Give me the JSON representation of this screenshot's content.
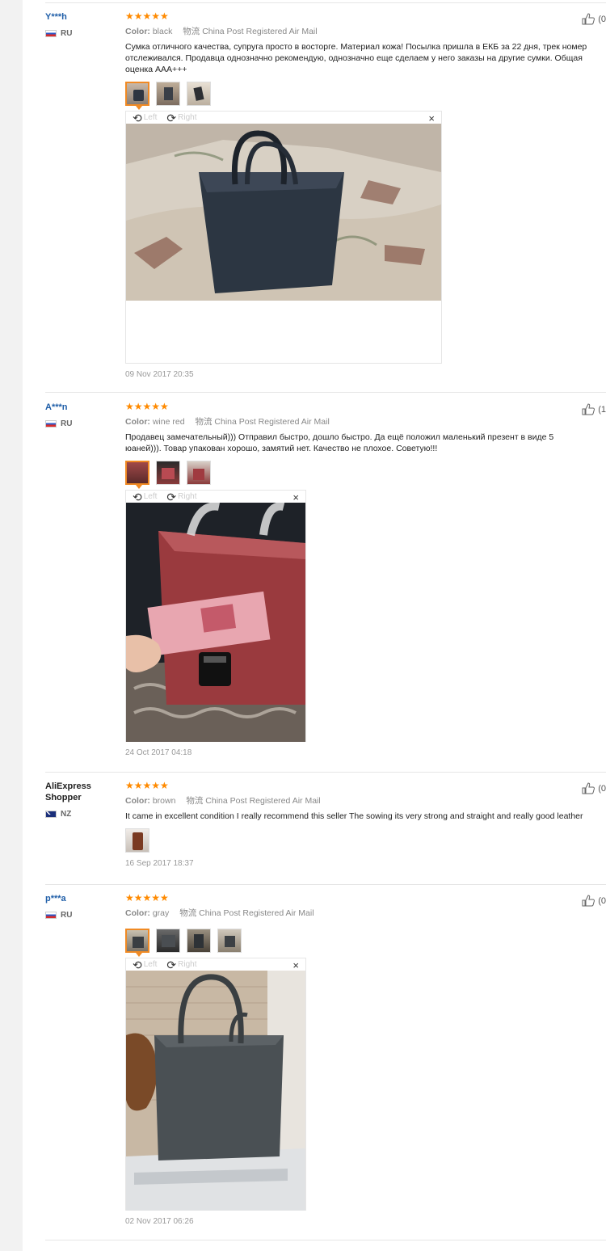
{
  "reviews": [
    {
      "user": "Y***h",
      "country": "RU",
      "stars": "★★★★★",
      "color_label": "Color:",
      "color": "black",
      "shipping_icon": "物流",
      "shipping": "China Post Registered Air Mail",
      "text": "Сумка отличного качества, супруга просто в восторге. Материал кожа! Посылка пришла в ЕКБ за 22 дня, трек номер отслеживался. Продавца однозначно рекомендую, однозначно еще сделаем у него заказы на другие сумки. Общая оценка AAA+++",
      "viewer_left": "Left",
      "viewer_right": "Right",
      "viewer_close": "×",
      "date": "09 Nov 2017 20:35",
      "likes": "(0"
    },
    {
      "user": "A***n",
      "country": "RU",
      "stars": "★★★★★",
      "color_label": "Color:",
      "color": "wine red",
      "shipping_icon": "物流",
      "shipping": "China Post Registered Air Mail",
      "text": "Продавец замечательный))) Отправил быстро, дошло быстро. Да ещё положил маленький презент в виде 5 юаней))). Товар упакован хорошо, замятий нет. Качество не плохое. Советую!!!",
      "viewer_left": "Left",
      "viewer_right": "Right",
      "viewer_close": "×",
      "date": "24 Oct 2017 04:18",
      "likes": "(1"
    },
    {
      "user": "AliExpress Shopper",
      "country": "NZ",
      "stars": "★★★★★",
      "color_label": "Color:",
      "color": "brown",
      "shipping_icon": "物流",
      "shipping": "China Post Registered Air Mail",
      "text": "It came in excellent condition I really recommend this seller The sowing its very strong and straight and really good leather",
      "date": "16 Sep 2017 18:37",
      "likes": "(0"
    },
    {
      "user": "p***a",
      "country": "RU",
      "stars": "★★★★★",
      "color_label": "Color:",
      "color": "gray",
      "shipping_icon": "物流",
      "shipping": "China Post Registered Air Mail",
      "viewer_left": "Left",
      "viewer_right": "Right",
      "viewer_close": "×",
      "date": "02 Nov 2017 06:26",
      "likes": "(0"
    }
  ]
}
